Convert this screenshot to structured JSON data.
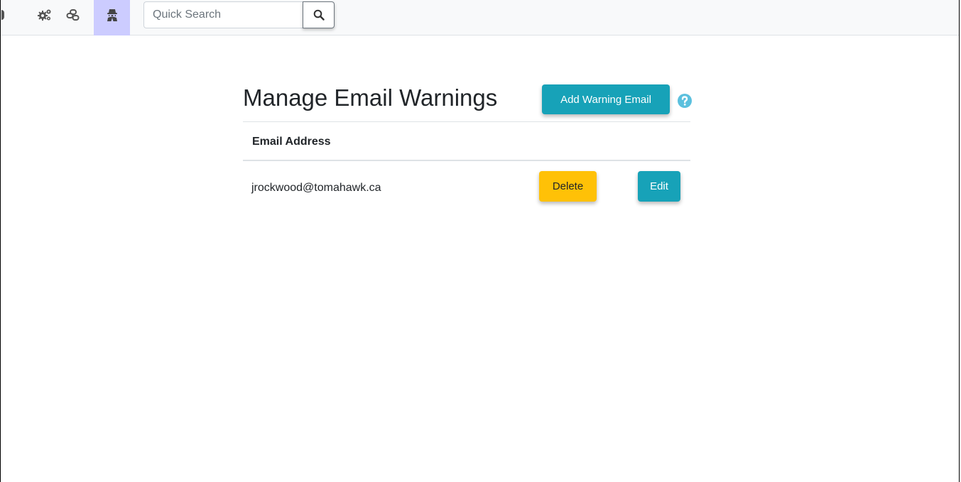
{
  "toolbar": {
    "icons": [
      {
        "name": "gears-icon",
        "active": false
      },
      {
        "name": "link-icon",
        "active": false
      },
      {
        "name": "user-secret-icon",
        "active": true
      }
    ],
    "search": {
      "placeholder": "Quick Search",
      "value": ""
    }
  },
  "main": {
    "title": "Manage Email Warnings",
    "add_button_label": "Add Warning Email",
    "help_icon": "question-circle-icon",
    "table": {
      "columns": [
        "Email Address"
      ],
      "rows": [
        {
          "email": "jrockwood@tomahawk.ca",
          "delete_label": "Delete",
          "edit_label": "Edit"
        }
      ]
    }
  },
  "colors": {
    "info": "#17a2b8",
    "warning": "#ffc107",
    "active_nav": "#ccccff",
    "help": "#5bc0de"
  }
}
